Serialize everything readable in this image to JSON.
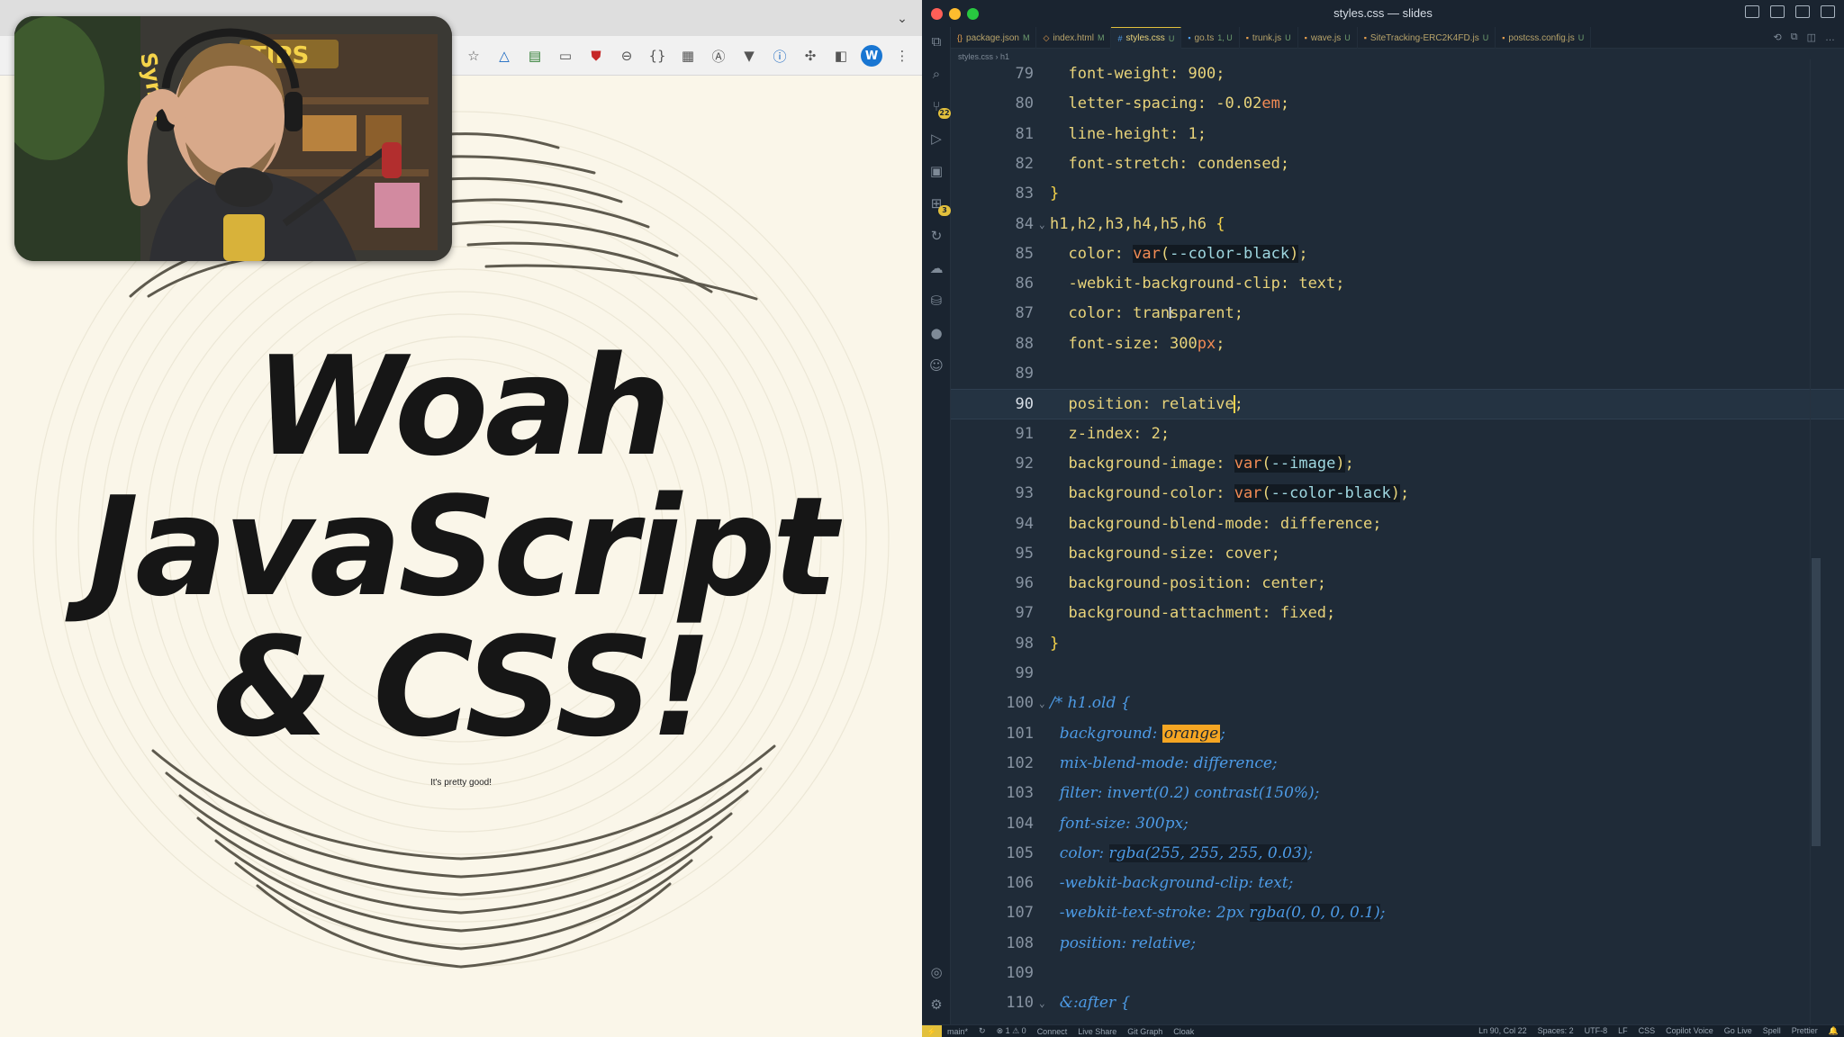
{
  "browser": {
    "toolbar_icons": [
      "star-icon",
      "drive-icon",
      "sheets-icon",
      "window-icon",
      "ublock-icon",
      "minus-circle-icon",
      "braces-icon",
      "grid-icon",
      "a-circle-icon",
      "vee-icon",
      "info-icon",
      "puzzle-icon",
      "sidebar-icon",
      "profile-icon",
      "more-icon"
    ],
    "profile_initial": "W",
    "page": {
      "title_lines": [
        "Woah",
        "JavaScript",
        "& CSS!"
      ],
      "subtitle": "It's pretty good!"
    }
  },
  "webcam": {
    "sign_text": "TIPS",
    "vertical_text": "Synta"
  },
  "vscode": {
    "window_title": "styles.css — slides",
    "tabs": [
      {
        "label": "package.json",
        "status": "M",
        "active": false
      },
      {
        "label": "index.html",
        "status": "M",
        "active": false
      },
      {
        "label": "styles.css",
        "status": "U",
        "active": true
      },
      {
        "label": "go.ts",
        "status": "1, U",
        "active": false
      },
      {
        "label": "trunk.js",
        "status": "U",
        "active": false
      },
      {
        "label": "wave.js",
        "status": "U",
        "active": false
      },
      {
        "label": "SiteTracking-ERC2K4FD.js",
        "status": "U",
        "active": false
      },
      {
        "label": "postcss.config.js",
        "status": "U",
        "active": false
      }
    ],
    "breadcrumb": "styles.css › h1",
    "activity_badges": {
      "source_control": "22",
      "extensions": "3"
    },
    "colors": {
      "accent": "#e2c03c",
      "editor_bg": "#1f2b38",
      "highlight": "#f5a623"
    },
    "lines": [
      {
        "n": "79",
        "t": "  font-weight: 900;"
      },
      {
        "n": "80",
        "t": "  letter-spacing: -0.02em;"
      },
      {
        "n": "81",
        "t": "  line-height: 1;"
      },
      {
        "n": "82",
        "t": "  font-stretch: condensed;"
      },
      {
        "n": "83",
        "t": "}"
      },
      {
        "n": "84",
        "t": "h1,h2,h3,h4,h5,h6 {"
      },
      {
        "n": "85",
        "t": "  color: var(--color-black);"
      },
      {
        "n": "86",
        "t": "  -webkit-background-clip: text;"
      },
      {
        "n": "87",
        "t": "  color: transparent;"
      },
      {
        "n": "88",
        "t": "  font-size: 300px;"
      },
      {
        "n": "89",
        "t": ""
      },
      {
        "n": "90",
        "t": "  position: relative;"
      },
      {
        "n": "91",
        "t": "  z-index: 2;"
      },
      {
        "n": "92",
        "t": "  background-image: var(--image);"
      },
      {
        "n": "93",
        "t": "  background-color: var(--color-black);"
      },
      {
        "n": "94",
        "t": "  background-blend-mode: difference;"
      },
      {
        "n": "95",
        "t": "  background-size: cover;"
      },
      {
        "n": "96",
        "t": "  background-position: center;"
      },
      {
        "n": "97",
        "t": "  background-attachment: fixed;"
      },
      {
        "n": "98",
        "t": "}"
      },
      {
        "n": "99",
        "t": ""
      },
      {
        "n": "100",
        "t": "/* h1.old {"
      },
      {
        "n": "101",
        "t": "  background: orange;"
      },
      {
        "n": "102",
        "t": "  mix-blend-mode: difference;"
      },
      {
        "n": "103",
        "t": "  filter: invert(0.2) contrast(150%);"
      },
      {
        "n": "104",
        "t": "  font-size: 300px;"
      },
      {
        "n": "105",
        "t": "  color: rgba(255, 255, 255, 0.03);"
      },
      {
        "n": "106",
        "t": "  -webkit-background-clip: text;"
      },
      {
        "n": "107",
        "t": "  -webkit-text-stroke: 2px rgba(0, 0, 0, 0.1);"
      },
      {
        "n": "108",
        "t": "  position: relative;"
      },
      {
        "n": "109",
        "t": ""
      },
      {
        "n": "110",
        "t": "  &:after {"
      }
    ],
    "status": {
      "branch": "main*",
      "problems": "⊗ 1 ⚠ 0",
      "connect": "Connect",
      "live_share": "Live Share",
      "git_graph": "Git Graph",
      "cloak": "Cloak",
      "cursor_pos": "Ln 90, Col 22",
      "spaces": "Spaces: 2",
      "encoding": "UTF-8",
      "eol": "LF",
      "language": "CSS",
      "copilot": "Copilot Voice",
      "go_live": "Go Live",
      "spell": "Spell",
      "prettier": "Prettier"
    }
  }
}
